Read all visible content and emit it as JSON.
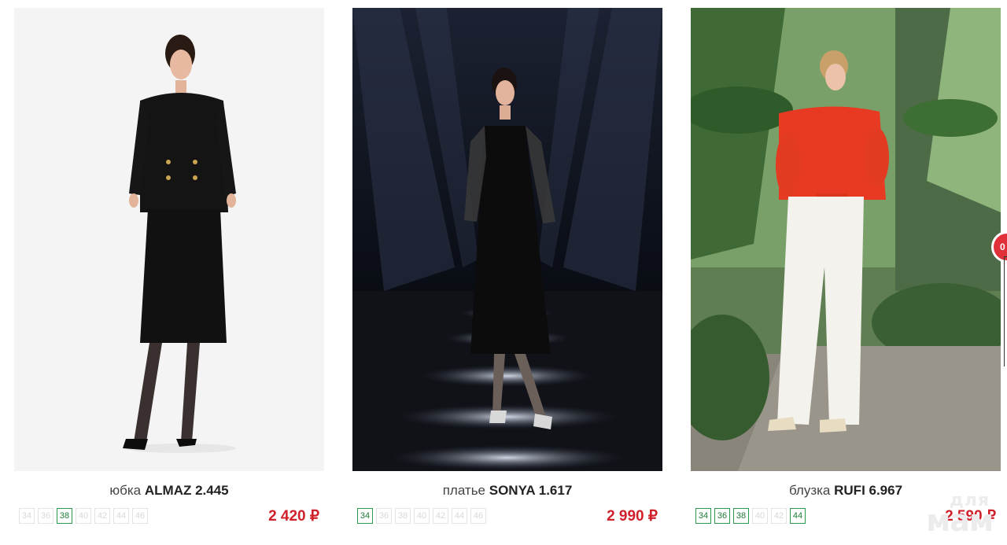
{
  "products": [
    {
      "kind": "юбка",
      "model": "ALMAZ 2.445",
      "price": "2 420 ₽",
      "image_alt": "Model in black double-breasted blazer and midi skirt",
      "sizes": [
        {
          "label": "34",
          "available": false
        },
        {
          "label": "36",
          "available": false
        },
        {
          "label": "38",
          "available": true
        },
        {
          "label": "40",
          "available": false
        },
        {
          "label": "42",
          "available": false
        },
        {
          "label": "44",
          "available": false
        },
        {
          "label": "46",
          "available": false
        }
      ]
    },
    {
      "kind": "платье",
      "model": "SONYA 1.617",
      "price": "2 990 ₽",
      "image_alt": "Model in black dress with sheer polka-dot sleeves on a runway",
      "sizes": [
        {
          "label": "34",
          "available": true
        },
        {
          "label": "36",
          "available": false
        },
        {
          "label": "38",
          "available": false
        },
        {
          "label": "40",
          "available": false
        },
        {
          "label": "42",
          "available": false
        },
        {
          "label": "44",
          "available": false
        },
        {
          "label": "46",
          "available": false
        }
      ]
    },
    {
      "kind": "блузка",
      "model": "RUFI 6.967",
      "price": "2 590 ₽",
      "image_alt": "Model in red off-shoulder blouse and white wide trousers in a greenhouse",
      "sizes": [
        {
          "label": "34",
          "available": true
        },
        {
          "label": "36",
          "available": true
        },
        {
          "label": "38",
          "available": true
        },
        {
          "label": "40",
          "available": false
        },
        {
          "label": "42",
          "available": false
        },
        {
          "label": "44",
          "available": true
        }
      ]
    }
  ],
  "side_badge": "0",
  "watermark": {
    "line1": "для",
    "line2": "мам"
  },
  "colors": {
    "price": "#d0202a",
    "available_size_border": "#2a9a4a",
    "unavailable_size_border": "#e4e4e4",
    "badge": "#e0313a"
  }
}
